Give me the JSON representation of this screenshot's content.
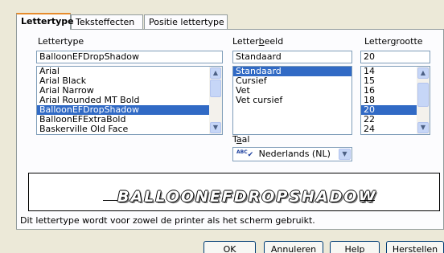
{
  "tabs": [
    {
      "label": "Lettertype",
      "active": true
    },
    {
      "label": "Teksteffecten",
      "active": false
    },
    {
      "label": "Positie lettertype",
      "active": false
    }
  ],
  "font": {
    "label_pre": "Lettertype",
    "value": "BalloonEFDropShadow",
    "items": [
      "Arial",
      "Arial Black",
      "Arial Narrow",
      "Arial Rounded MT Bold",
      "BalloonEFDropShadow",
      "BalloonEFExtraBold",
      "Baskerville Old Face"
    ],
    "selected_index": 4
  },
  "style": {
    "label_pre": "Letter",
    "label_hotkey": "b",
    "label_post": "eeld",
    "value": "Standaard",
    "items": [
      "Standaard",
      "Cursief",
      "Vet",
      "Vet cursief"
    ],
    "selected_index": 0
  },
  "size": {
    "label_pre": "Letter",
    "label_hotkey": "g",
    "label_post": "rootte",
    "value": "20",
    "items": [
      "14",
      "15",
      "16",
      "18",
      "20",
      "22",
      "24"
    ],
    "selected_index": 4
  },
  "language": {
    "label_pre": "T",
    "label_hotkey": "a",
    "label_post": "al",
    "value": "Nederlands (NL)",
    "spell_icon_text": "ABC"
  },
  "preview": {
    "text": "BALLOONEFDROPSHADOW"
  },
  "info_text": "Dit lettertype wordt voor zowel de printer als het scherm gebruikt.",
  "buttons": {
    "ok": "OK",
    "cancel": "Annuleren",
    "help_hotkey": "H",
    "help_rest": "elp",
    "reset_hotkey": "H",
    "reset_rest": "erstellen"
  },
  "colors": {
    "selection": "#316ac5",
    "tab_highlight": "#e68b2c",
    "dialog_bg": "#ece9d8"
  }
}
